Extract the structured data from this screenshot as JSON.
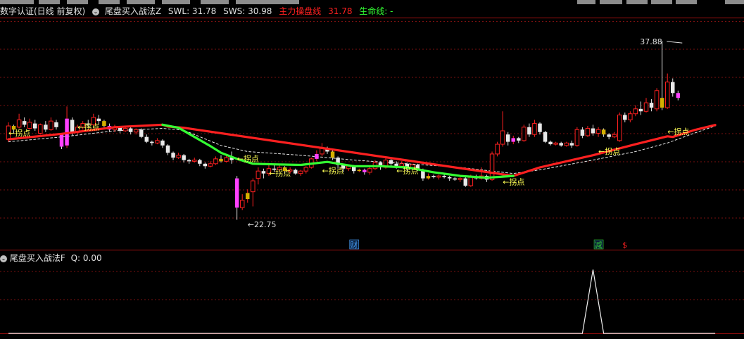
{
  "header": {
    "symbol_label": "数字认证(日线 前复权)",
    "indicator_name": "尾盘买入战法Z",
    "swl_label": "SWL: 31.78",
    "sws_label": "SWS: 30.98",
    "main_line_label": "主力操盘线",
    "main_line_value": "31.78",
    "life_line_label": "生命线: -"
  },
  "sub_header": {
    "indicator_name": "尾盘买入战法F",
    "q_label": "Q: 0.00"
  },
  "colors": {
    "background": "#000000",
    "up": "#ff2020",
    "down_body": "#e8e8e8",
    "highlight_up": "#d4b000",
    "highlight_alt": "#ff40ff",
    "main_line": "#ff2020",
    "life_line": "#33ff33",
    "grid": "#7a1010",
    "label_yellow": "#ffff55",
    "event_blue": "#4aa3ff",
    "event_green": "#33cc33"
  },
  "chart_data": [
    {
      "type": "candlestick",
      "title": "数字认证(日线 前复权)",
      "y_extremes": {
        "max": 37.88,
        "min": 22.75
      },
      "ylim": [
        21.5,
        39.5
      ],
      "grid": "horizontal dashed",
      "candles": [
        [
          29.8,
          30.9,
          31.2,
          29.6
        ],
        [
          30.9,
          30.6,
          31.0,
          30.3
        ],
        [
          30.8,
          31.4,
          31.9,
          30.7
        ],
        [
          31.3,
          31.0,
          31.6,
          30.8
        ],
        [
          30.7,
          31.2,
          31.5,
          30.6
        ],
        [
          31.1,
          30.7,
          31.4,
          30.5
        ],
        [
          30.3,
          31.0,
          31.1,
          30.2
        ],
        [
          31.0,
          30.6,
          31.3,
          30.4
        ],
        [
          30.6,
          31.3,
          31.6,
          30.5
        ],
        [
          31.2,
          30.8,
          31.4,
          30.6
        ],
        [
          30.2,
          29.2,
          30.3,
          29.0
        ],
        [
          29.3,
          31.5,
          32.5,
          29.1
        ],
        [
          31.4,
          30.4,
          31.6,
          30.1
        ],
        [
          30.4,
          30.8,
          31.0,
          30.2
        ],
        [
          30.8,
          31.1,
          31.3,
          30.6
        ],
        [
          31.1,
          31.0,
          31.4,
          30.8
        ],
        [
          31.0,
          31.6,
          31.9,
          30.9
        ],
        [
          31.5,
          31.3,
          31.8,
          31.0
        ],
        [
          31.3,
          30.9,
          31.4,
          30.8
        ],
        [
          30.9,
          30.6,
          31.1,
          30.4
        ],
        [
          30.6,
          30.8,
          31.0,
          30.4
        ],
        [
          30.8,
          30.5,
          30.9,
          30.3
        ],
        [
          30.5,
          30.7,
          30.9,
          30.4
        ],
        [
          30.7,
          30.4,
          30.8,
          30.2
        ],
        [
          30.4,
          30.6,
          30.7,
          30.2
        ],
        [
          30.6,
          30.0,
          30.7,
          29.9
        ],
        [
          30.0,
          29.6,
          30.2,
          29.5
        ],
        [
          29.6,
          29.5,
          29.7,
          29.3
        ],
        [
          29.5,
          29.7,
          29.9,
          29.4
        ],
        [
          29.7,
          29.3,
          29.8,
          29.1
        ],
        [
          29.3,
          28.7,
          29.4,
          28.5
        ],
        [
          28.7,
          28.3,
          28.8,
          28.1
        ],
        [
          28.3,
          28.5,
          28.7,
          28.2
        ],
        [
          28.5,
          28.1,
          28.6,
          27.9
        ],
        [
          28.1,
          28.0,
          28.2,
          27.8
        ],
        [
          28.0,
          28.1,
          28.3,
          27.9
        ],
        [
          28.1,
          27.8,
          28.2,
          27.6
        ],
        [
          27.8,
          27.6,
          27.9,
          27.4
        ],
        [
          27.6,
          27.8,
          28.0,
          27.5
        ],
        [
          27.8,
          28.2,
          28.4,
          27.7
        ],
        [
          28.2,
          28.0,
          28.5,
          27.9
        ],
        [
          28.0,
          28.3,
          28.6,
          27.9
        ],
        [
          28.3,
          28.1,
          28.8,
          27.8
        ],
        [
          26.6,
          24.2,
          26.8,
          23.2
        ],
        [
          24.2,
          24.8,
          25.3,
          24.0
        ],
        [
          24.9,
          25.4,
          25.7,
          24.6
        ],
        [
          25.5,
          26.4,
          26.6,
          24.3
        ],
        [
          26.6,
          27.2,
          27.5,
          26.1
        ],
        [
          27.2,
          27.0,
          27.4,
          26.6
        ],
        [
          27.0,
          27.4,
          27.7,
          26.8
        ],
        [
          27.4,
          27.3,
          27.8,
          27.1
        ],
        [
          27.3,
          27.5,
          27.7,
          27.2
        ],
        [
          27.5,
          27.2,
          27.6,
          27.0
        ],
        [
          27.2,
          27.3,
          27.5,
          27.0
        ],
        [
          27.3,
          27.0,
          27.4,
          26.9
        ],
        [
          27.0,
          27.2,
          27.3,
          26.8
        ],
        [
          27.2,
          27.5,
          27.6,
          27.0
        ],
        [
          27.5,
          28.2,
          28.3,
          27.4
        ],
        [
          28.2,
          28.6,
          28.9,
          28.0
        ],
        [
          28.6,
          29.1,
          29.5,
          28.4
        ],
        [
          29.1,
          28.8,
          29.2,
          28.6
        ],
        [
          28.8,
          28.3,
          28.9,
          28.1
        ],
        [
          28.3,
          27.7,
          28.4,
          27.4
        ],
        [
          27.7,
          27.4,
          27.8,
          27.1
        ],
        [
          27.4,
          27.6,
          27.7,
          27.2
        ],
        [
          27.6,
          27.2,
          27.7,
          27.0
        ],
        [
          27.2,
          27.3,
          27.4,
          27.1
        ],
        [
          27.3,
          27.1,
          27.4,
          26.9
        ],
        [
          27.1,
          27.4,
          27.6,
          26.9
        ],
        [
          27.4,
          27.9,
          28.1,
          27.3
        ],
        [
          27.9,
          27.5,
          28.0,
          27.3
        ],
        [
          27.5,
          28.1,
          28.3,
          27.4
        ],
        [
          28.1,
          27.8,
          28.3,
          27.6
        ],
        [
          27.8,
          27.6,
          28.0,
          27.4
        ],
        [
          27.6,
          27.8,
          28.0,
          27.5
        ],
        [
          27.8,
          27.5,
          27.9,
          27.2
        ],
        [
          27.5,
          27.7,
          27.8,
          27.4
        ],
        [
          27.7,
          27.3,
          27.8,
          27.2
        ],
        [
          27.3,
          26.6,
          27.4,
          26.4
        ],
        [
          26.6,
          26.8,
          27.0,
          26.5
        ],
        [
          26.8,
          26.7,
          26.9,
          26.6
        ],
        [
          26.7,
          26.8,
          26.9,
          26.5
        ],
        [
          26.8,
          26.7,
          26.9,
          26.6
        ],
        [
          26.7,
          26.6,
          26.8,
          26.4
        ],
        [
          26.6,
          26.5,
          26.7,
          26.4
        ],
        [
          26.5,
          26.6,
          26.7,
          26.3
        ],
        [
          26.6,
          26.0,
          26.7,
          25.9
        ],
        [
          26.0,
          26.7,
          26.9,
          25.9
        ],
        [
          26.7,
          26.6,
          26.9,
          26.5
        ],
        [
          26.6,
          26.8,
          27.5,
          26.5
        ],
        [
          26.8,
          26.5,
          26.9,
          26.3
        ],
        [
          26.5,
          28.6,
          28.8,
          26.4
        ],
        [
          28.6,
          29.4,
          29.6,
          28.4
        ],
        [
          29.4,
          30.5,
          32.1,
          29.2
        ],
        [
          30.2,
          29.6,
          30.4,
          29.3
        ],
        [
          29.6,
          29.9,
          30.1,
          29.4
        ],
        [
          29.9,
          29.7,
          30.0,
          29.5
        ],
        [
          29.7,
          30.8,
          31.0,
          29.6
        ],
        [
          30.8,
          30.2,
          31.1,
          30.0
        ],
        [
          30.2,
          31.1,
          31.4,
          30.0
        ],
        [
          31.1,
          30.4,
          31.2,
          30.2
        ],
        [
          30.4,
          29.6,
          30.5,
          29.5
        ],
        [
          29.6,
          29.4,
          29.7,
          29.3
        ],
        [
          29.4,
          29.5,
          29.6,
          29.3
        ],
        [
          29.5,
          29.3,
          29.6,
          29.2
        ],
        [
          29.3,
          29.5,
          29.6,
          29.2
        ],
        [
          29.5,
          29.3,
          29.7,
          29.1
        ],
        [
          29.3,
          30.6,
          30.8,
          29.2
        ],
        [
          30.6,
          30.1,
          30.8,
          29.9
        ],
        [
          30.1,
          30.7,
          30.9,
          30.0
        ],
        [
          30.7,
          30.3,
          31.0,
          30.1
        ],
        [
          30.3,
          30.6,
          30.8,
          30.0
        ],
        [
          30.6,
          30.2,
          30.7,
          30.0
        ],
        [
          30.2,
          30.0,
          30.3,
          29.8
        ],
        [
          30.0,
          30.2,
          30.4,
          29.9
        ],
        [
          29.7,
          31.8,
          32.0,
          29.6
        ],
        [
          31.8,
          31.4,
          32.0,
          31.2
        ],
        [
          31.4,
          31.9,
          32.1,
          31.2
        ],
        [
          31.9,
          32.3,
          32.6,
          31.7
        ],
        [
          32.3,
          32.1,
          32.9,
          31.8
        ],
        [
          32.1,
          32.8,
          33.2,
          32.0
        ],
        [
          32.8,
          32.4,
          33.1,
          32.1
        ],
        [
          32.3,
          33.8,
          34.0,
          32.1
        ],
        [
          33.2,
          32.4,
          37.88,
          32.2
        ],
        [
          32.4,
          34.5,
          35.2,
          32.3
        ],
        [
          34.5,
          33.6,
          34.8,
          33.3
        ],
        [
          33.6,
          33.2,
          33.8,
          33.0
        ]
      ],
      "highlight_up_index": [
        1,
        18,
        40,
        45,
        52,
        61,
        66,
        79,
        112,
        123
      ],
      "highlight_alt_index": [
        10,
        11,
        19,
        43,
        58,
        67,
        95,
        126
      ],
      "series": [
        {
          "name": "主力操盘线",
          "color": "red",
          "x": [
            0,
            10,
            20,
            29,
            30,
            33,
            95,
            100,
            110,
            118,
            124,
            125,
            129,
            133
          ],
          "y": [
            29.8,
            30.25,
            30.8,
            31.0,
            30.85,
            30.75,
            26.8,
            27.5,
            28.5,
            29.4,
            30.05,
            30.0,
            30.55,
            30.98
          ]
        },
        {
          "name": "生命线",
          "color": "green",
          "x": [
            29,
            32,
            35,
            38,
            40,
            43,
            46,
            50,
            55,
            60,
            65,
            70,
            75,
            80,
            85,
            90,
            95
          ],
          "y": [
            31.0,
            30.75,
            30.0,
            29.25,
            28.7,
            28.2,
            27.8,
            27.75,
            27.7,
            27.95,
            27.6,
            27.6,
            27.5,
            27.1,
            26.8,
            26.65,
            26.8
          ]
        },
        {
          "name": "support",
          "color": "white dashed",
          "x": [
            0,
            10,
            20,
            29,
            33,
            40,
            45,
            55,
            65,
            75,
            85,
            95,
            100,
            110,
            118,
            124,
            129,
            133
          ],
          "y": [
            29.6,
            30.0,
            30.5,
            30.7,
            30.55,
            29.3,
            28.8,
            28.5,
            28.1,
            27.8,
            27.5,
            27.0,
            27.3,
            28.1,
            28.8,
            29.5,
            30.3,
            30.9
          ]
        }
      ],
      "annotations": [
        {
          "text": "←拐点",
          "x": 0,
          "y": 30.1
        },
        {
          "text": "←拐点",
          "x": 13,
          "y": 30.6
        },
        {
          "text": "←拐点",
          "x": 43,
          "y": 28.0
        },
        {
          "text": "←拐点",
          "x": 49,
          "y": 26.8
        },
        {
          "text": "←拐点",
          "x": 59,
          "y": 27.0
        },
        {
          "text": "←拐点",
          "x": 73,
          "y": 27.0
        },
        {
          "text": "←拐点",
          "x": 93,
          "y": 26.1
        },
        {
          "text": "←拐点",
          "x": 111,
          "y": 28.6
        },
        {
          "text": "←拐点",
          "x": 124,
          "y": 30.2
        },
        {
          "text": "37.88",
          "x": 126,
          "y": 37.6
        },
        {
          "text": "←22.75",
          "x": 45,
          "y": 22.6
        }
      ],
      "events": [
        {
          "text": "财",
          "x": 65,
          "color": "blue"
        },
        {
          "text": "减",
          "x": 111,
          "color": "green"
        },
        {
          "text": "$",
          "x": 116,
          "color": "red"
        }
      ]
    },
    {
      "type": "line",
      "title": "尾盘买入战法F",
      "series": [
        {
          "name": "Q",
          "x": [
            0,
            108,
            110,
            112,
            133
          ],
          "y": [
            0,
            0,
            1,
            0,
            0
          ]
        }
      ],
      "ylim": [
        0,
        1.08
      ]
    }
  ]
}
